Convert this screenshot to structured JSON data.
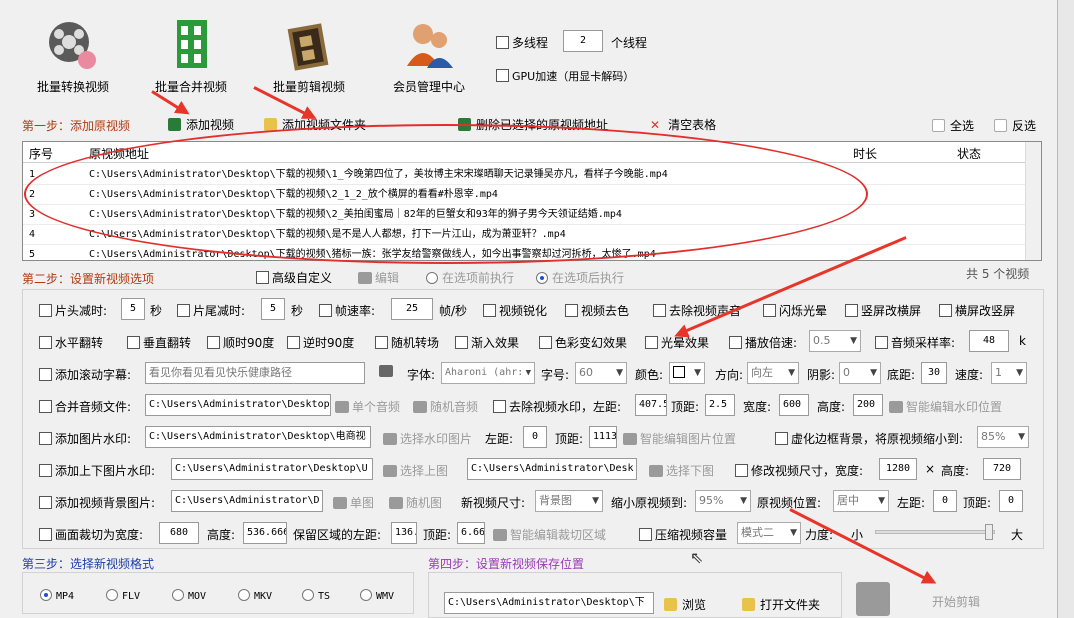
{
  "toolbar": {
    "batch_convert": "批量转换视频",
    "batch_merge": "批量合并视频",
    "batch_clip": "批量剪辑视频",
    "member": "会员管理中心"
  },
  "threads": {
    "label": "多线程",
    "value": "2",
    "unit": "个线程"
  },
  "gpu": {
    "label": "GPU加速（用显卡解码）"
  },
  "step1": {
    "title": "第一步：添加原视频",
    "add_video": "添加视频",
    "add_folder": "添加视频文件夹",
    "delete_selected": "删除已选择的原视频地址",
    "clear": "清空表格",
    "select_all": "全选",
    "invert": "反选"
  },
  "table": {
    "columns": [
      "序号",
      "原视频地址",
      "时长",
      "状态"
    ],
    "rows": [
      {
        "n": "1",
        "path": "C:\\Users\\Administrator\\Desktop\\下载的视频\\1_今晚第四位了，美妆博主宋宋璨晒聊天记录锤吴亦凡，看样子今晚能.mp4"
      },
      {
        "n": "2",
        "path": "C:\\Users\\Administrator\\Desktop\\下载的视频\\2_1_2_放个横屏的看看#朴恩宰.mp4"
      },
      {
        "n": "3",
        "path": "C:\\Users\\Administrator\\Desktop\\下载的视频\\2_美拍闺蜜局｜82年的巨蟹女和93年的狮子男今天领证结婚.mp4"
      },
      {
        "n": "4",
        "path": "C:\\Users\\Administrator\\Desktop\\下载的视频\\是不是人人都想，打下一片江山，成为萧亚轩？.mp4"
      },
      {
        "n": "5",
        "path": "C:\\Users\\Administrator\\Desktop\\下载的视频\\猪标一族：张学友给警察做线人，如今出事警察却过河拆桥，太惨了.mp4"
      }
    ]
  },
  "step2": {
    "title": "第二步：设置新视频选项",
    "advanced": "高级自定义",
    "edit": "编辑",
    "before": "在选项前执行",
    "after": "在选项后执行",
    "count": "共 5 个视频"
  },
  "opts": {
    "head_cut": "片头减时:",
    "head_val": "5",
    "sec": "秒",
    "tail_cut": "片尾减时:",
    "tail_val": "5",
    "frame_rate": "帧速率:",
    "frame_val": "25",
    "fps_unit": "帧/秒",
    "sharpen": "视频锐化",
    "decolor": "视频去色",
    "mute": "去除视频声音",
    "flash": "闪烁光晕",
    "v2h": "竖屏改横屏",
    "h2v": "横屏改竖屏",
    "hflip": "水平翻转",
    "vflip": "垂直翻转",
    "cw90": "顺时90度",
    "ccw90": "逆时90度",
    "rand_trans": "随机转场",
    "fade_in": "渐入效果",
    "color_fx": "色彩变幻效果",
    "light_fx": "光晕效果",
    "speed": "播放倍速:",
    "speed_val": "0.5",
    "sample": "音频采样率:",
    "sample_val": "48",
    "sample_unit": "k",
    "subtitle": "添加滚动字幕:",
    "subtitle_val": "看见你看见看见快乐健康路径",
    "font": "字体:",
    "font_val": "Aharoni (ahr:",
    "size": "字号:",
    "size_val": "60",
    "color": "颜色:",
    "dir": "方向:",
    "dir_val": "向左",
    "shadow": "阴影:",
    "shadow_val": "0",
    "bottom": "底距:",
    "bottom_val": "30",
    "spd": "速度:",
    "spd_val": "1",
    "merge_audio": "合并音频文件:",
    "merge_audio_val": "C:\\Users\\Administrator\\Desktop",
    "single_audio": "单个音频",
    "rand_audio": "随机音频",
    "remove_wm": "去除视频水印，左距:",
    "wm_left": "407.5",
    "top": "顶距:",
    "wm_top": "2.5",
    "width": "宽度:",
    "wm_width": "600",
    "height": "高度:",
    "wm_height": "200",
    "smart_wm": "智能编辑水印位置",
    "img_wm": "添加图片水印:",
    "img_wm_val": "C:\\Users\\Administrator\\Desktop\\电商视",
    "sel_img": "选择水印图片",
    "left": "左距:",
    "img_left": "0",
    "img_top": "1113",
    "smart_img": "智能编辑图片位置",
    "blur_bg": "虚化边框背景，将原视频缩小到:",
    "blur_val": "85%",
    "updown": "添加上下图片水印:",
    "up_val": "C:\\Users\\Administrator\\Desktop\\U",
    "sel_up": "选择上图",
    "down_val": "C:\\Users\\Administrator\\Desk",
    "sel_down": "选择下图",
    "resize": "修改视频尺寸，宽度:",
    "resize_w": "1280",
    "x": "×",
    "resize_h_label": "高度:",
    "resize_h": "720",
    "bg_img": "添加视频背景图片:",
    "bg_val": "C:\\Users\\Administrator\\D",
    "single_img": "单图",
    "rand_img": "随机图",
    "new_size": "新视频尺寸:",
    "new_size_val": "背景图",
    "shrink": "缩小原视频到:",
    "shrink_val": "95%",
    "pos": "原视频位置:",
    "pos_val": "居中",
    "pos_left": "左距:",
    "pos_left_val": "0",
    "pos_top": "顶距:",
    "pos_top_val": "0",
    "crop": "画面裁切为宽度:",
    "crop_w": "680",
    "crop_h_label": "高度:",
    "crop_h": "536.666",
    "keep_left": "保留区域的左距:",
    "keep_left_val": "136.",
    "keep_top": "顶距:",
    "keep_top_val": "6.66",
    "smart_crop": "智能编辑裁切区域",
    "compress": "压缩视频容量",
    "mode": "模式二",
    "strength": "力度:",
    "small": "小",
    "big": "大"
  },
  "step3": {
    "title": "第三步：选择新视频格式",
    "formats": [
      "MP4",
      "FLV",
      "MOV",
      "MKV",
      "TS",
      "WMV"
    ]
  },
  "step4": {
    "title": "第四步：设置新视频保存位置",
    "path": "C:\\Users\\Administrator\\Desktop\\下",
    "browse": "浏览",
    "open": "打开文件夹",
    "start": "开始剪辑"
  },
  "colors": {
    "arrow": "#e8352a",
    "step1": "#b23b12",
    "step2": "#1e3ea8",
    "step4": "#9b3ab8"
  }
}
